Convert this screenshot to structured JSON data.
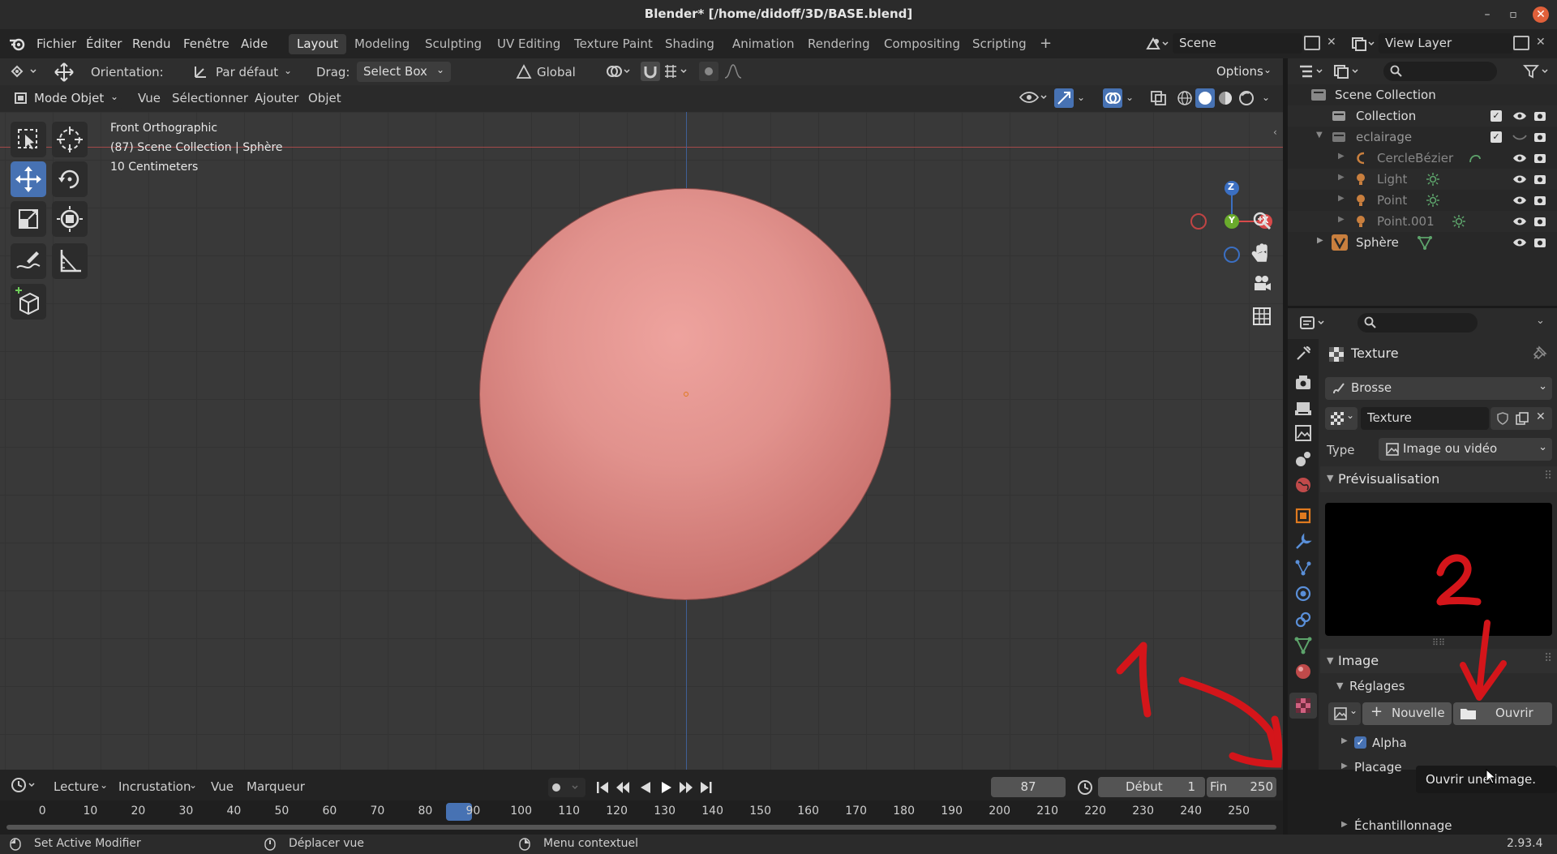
{
  "window": {
    "title": "Blender* [/home/didoff/3D/BASE.blend]",
    "minimize": "–",
    "maximize": "▫",
    "close": "✕"
  },
  "menu": {
    "items": [
      "Fichier",
      "Éditer",
      "Rendu",
      "Fenêtre",
      "Aide"
    ]
  },
  "workspaces": {
    "tabs": [
      "Layout",
      "Modeling",
      "Sculpting",
      "UV Editing",
      "Texture Paint",
      "Shading",
      "Animation",
      "Rendering",
      "Compositing",
      "Scripting"
    ],
    "active": "Layout",
    "add": "+"
  },
  "scene": {
    "name": "Scene",
    "view_layer": "View Layer"
  },
  "tool_header": {
    "orientation_label": "Orientation:",
    "orientation_value": "Par défaut",
    "drag_label": "Drag:",
    "drag_value": "Select Box",
    "transform": "Global",
    "options": "Options"
  },
  "viewport_header": {
    "mode": "Mode Objet",
    "menus": [
      "Vue",
      "Sélectionner",
      "Ajouter",
      "Objet"
    ]
  },
  "viewport": {
    "view_name": "Front Orthographic",
    "collection_info": "(87) Scene Collection | Sphère",
    "scale": "10 Centimeters",
    "gizmo": {
      "z": "Z",
      "y": "Y",
      "x": "X"
    }
  },
  "outliner": {
    "rows": [
      {
        "label": "Scene Collection",
        "indent": 0
      },
      {
        "label": "Collection",
        "indent": 1
      },
      {
        "label": "eclairage",
        "indent": 1
      },
      {
        "label": "CercleBézier",
        "indent": 2
      },
      {
        "label": "Light",
        "indent": 2
      },
      {
        "label": "Point",
        "indent": 2
      },
      {
        "label": "Point.001",
        "indent": 2
      },
      {
        "label": "Sphère",
        "indent": 1
      }
    ]
  },
  "properties": {
    "context": "Texture",
    "brush": "Brosse",
    "texture_name": "Texture",
    "type_label": "Type",
    "type_value": "Image ou vidéo",
    "preview_section": "Prévisualisation",
    "image_section": "Image",
    "settings_section": "Réglages",
    "new_button": "Nouvelle",
    "open_button": "Ouvrir",
    "tooltip": "Ouvrir une image.",
    "alpha_label": "Alpha",
    "mapping_section": "Placage",
    "sampling_section": "Échantillonnage"
  },
  "annotations": {
    "one": "1",
    "two": "2",
    "color": "#d4151a"
  },
  "timeline": {
    "menus": [
      "Lecture",
      "Incrustation",
      "Vue",
      "Marqueur"
    ],
    "current_frame": "87",
    "start_label": "Début",
    "start": "1",
    "end_label": "Fin",
    "end": "250",
    "ticks": [
      "0",
      "10",
      "20",
      "30",
      "40",
      "50",
      "60",
      "70",
      "80",
      "90",
      "100",
      "110",
      "120",
      "130",
      "140",
      "150",
      "160",
      "170",
      "180",
      "190",
      "200",
      "210",
      "220",
      "230",
      "240",
      "250"
    ]
  },
  "statusbar": {
    "left": "Set Active Modifier",
    "middle": "Déplacer vue",
    "right": "Menu contextuel",
    "version": "2.93.4"
  },
  "colors": {
    "accent": "#4772b3",
    "sphere": "#e1928d",
    "annotation": "#d4151a"
  }
}
